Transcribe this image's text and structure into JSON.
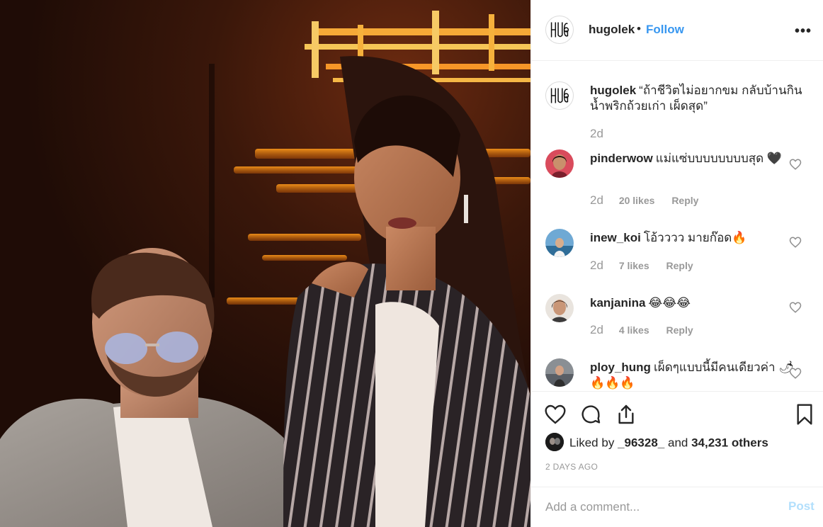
{
  "post": {
    "username": "hugolek",
    "separator": "•",
    "follow_label": "Follow",
    "more_label": "•••",
    "photo_alt": "photo-post"
  },
  "caption": {
    "username": "hugolek",
    "text": "“ถ้าชีวิตไม่อยากขม กลับบ้านกินน้ำพริกถ้วยเก่า เผ็ดสุด”",
    "time": "2d"
  },
  "comments": [
    {
      "username": "pinderwow",
      "text": "แม่แซ่บบบบบบบบสุด 🖤",
      "time": "2d",
      "likes": "20 likes",
      "reply": "Reply"
    },
    {
      "username": "inew_koi",
      "text": "โอ้วววว มายก๊อด🔥",
      "time": "2d",
      "likes": "7 likes",
      "reply": "Reply"
    },
    {
      "username": "kanjanina",
      "text": "😂😂😂",
      "time": "2d",
      "likes": "4 likes",
      "reply": "Reply"
    },
    {
      "username": "ploy_hung",
      "text": "เผ็ดๆแบบนี้มีคนเดียวค่า 🌶🔥🔥🔥",
      "time": "",
      "likes": "",
      "reply": ""
    }
  ],
  "actions": {
    "liked_prefix": "Liked by",
    "liked_user": "_96328_",
    "liked_and": "and",
    "liked_others": "34,231 others",
    "date": "2 DAYS AGO"
  },
  "add_comment": {
    "placeholder": "Add a comment...",
    "post_label": "Post"
  },
  "colors": {
    "link": "#3897f0",
    "post_disabled": "#b2dffc",
    "muted": "#999999"
  }
}
